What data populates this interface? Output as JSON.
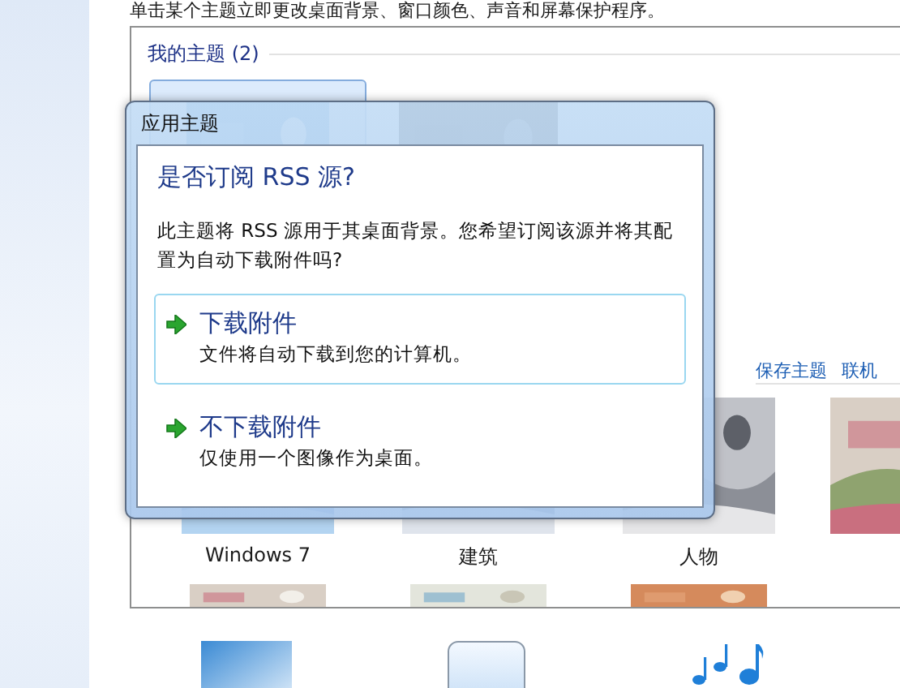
{
  "intro": "单击某个主题立即更改桌面背景、窗口颜色、声音和屏幕保护程序。",
  "my_themes": {
    "title": "我的主题 (2)",
    "themes": [
      {
        "selected": true
      },
      {
        "selected": false
      }
    ]
  },
  "aero_themes": {
    "links": [
      "保存主题",
      "联机"
    ],
    "labels": [
      "Windows 7",
      "建筑",
      "人物"
    ]
  },
  "dialog": {
    "title": "应用主题",
    "heading": "是否订阅 RSS 源?",
    "description": "此主题将 RSS 源用于其桌面背景。您希望订阅该源并将其配置为自动下载附件吗?",
    "options": [
      {
        "title": "下载附件",
        "description": "文件将自动下载到您的计算机。",
        "selected": true
      },
      {
        "title": "不下载附件",
        "description": "仅使用一个图像作为桌面。",
        "selected": false
      }
    ]
  }
}
